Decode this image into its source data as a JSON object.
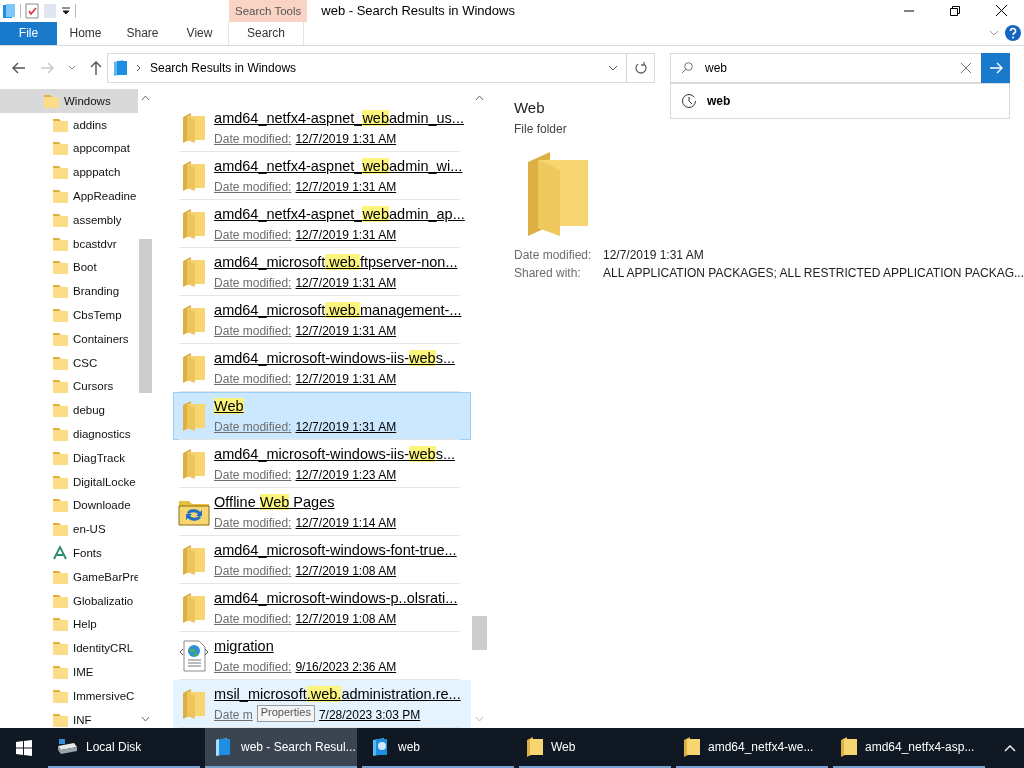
{
  "window": {
    "title": "web - Search Results in Windows",
    "contextual_tab": "Search Tools"
  },
  "ribbon_tabs": [
    {
      "label": "File",
      "kind": "file"
    },
    {
      "label": "Home",
      "kind": "plain"
    },
    {
      "label": "Share",
      "kind": "plain"
    },
    {
      "label": "View",
      "kind": "plain"
    },
    {
      "label": "Search",
      "kind": "contextual"
    }
  ],
  "address": {
    "path": "Search Results in Windows"
  },
  "search": {
    "value": "web",
    "suggestions": [
      "web"
    ]
  },
  "nav_tree": [
    {
      "label": "Windows",
      "kind": "folder",
      "selected": true,
      "children": [
        {
          "label": "addins",
          "kind": "folder",
          "selected": false
        },
        {
          "label": "appcompat",
          "kind": "folder",
          "selected": false
        },
        {
          "label": "apppatch",
          "kind": "folder",
          "selected": false
        },
        {
          "label": "AppReadine",
          "kind": "folder",
          "selected": false
        },
        {
          "label": "assembly",
          "kind": "folder",
          "selected": false
        },
        {
          "label": "bcastdvr",
          "kind": "folder",
          "selected": false
        },
        {
          "label": "Boot",
          "kind": "folder",
          "selected": false
        },
        {
          "label": "Branding",
          "kind": "folder",
          "selected": false
        },
        {
          "label": "CbsTemp",
          "kind": "folder",
          "selected": false
        },
        {
          "label": "Containers",
          "kind": "folder",
          "selected": false
        },
        {
          "label": "CSC",
          "kind": "folder",
          "selected": false
        },
        {
          "label": "Cursors",
          "kind": "folder",
          "selected": false
        },
        {
          "label": "debug",
          "kind": "folder",
          "selected": false
        },
        {
          "label": "diagnostics",
          "kind": "folder",
          "selected": false
        },
        {
          "label": "DiagTrack",
          "kind": "folder",
          "selected": false
        },
        {
          "label": "DigitalLocke",
          "kind": "folder",
          "selected": false
        },
        {
          "label": "Downloade",
          "kind": "folder",
          "selected": false
        },
        {
          "label": "en-US",
          "kind": "folder",
          "selected": false
        },
        {
          "label": "Fonts",
          "kind": "font",
          "selected": false
        },
        {
          "label": "GameBarPre",
          "kind": "folder",
          "selected": false
        },
        {
          "label": "Globalizatio",
          "kind": "folder",
          "selected": false
        },
        {
          "label": "Help",
          "kind": "folder",
          "selected": false
        },
        {
          "label": "IdentityCRL",
          "kind": "folder",
          "selected": false
        },
        {
          "label": "IME",
          "kind": "folder",
          "selected": false
        },
        {
          "label": "ImmersiveC",
          "kind": "folder",
          "selected": false
        },
        {
          "label": "INF",
          "kind": "folder",
          "selected": false
        }
      ]
    }
  ],
  "results": [
    {
      "kind": "folder",
      "selected": false,
      "hovered": false,
      "name": [
        {
          "text": "amd64_netfx4-aspnet_",
          "match": false
        },
        {
          "text": "web",
          "match": true
        },
        {
          "text": "admin_us...",
          "match": false
        }
      ],
      "date_label": "Date modified:",
      "date": "12/7/2019 1:31 AM"
    },
    {
      "kind": "folder",
      "selected": false,
      "hovered": false,
      "name": [
        {
          "text": "amd64_netfx4-aspnet_",
          "match": false
        },
        {
          "text": "web",
          "match": true
        },
        {
          "text": "admin_wi...",
          "match": false
        }
      ],
      "date_label": "Date modified:",
      "date": "12/7/2019 1:31 AM"
    },
    {
      "kind": "folder",
      "selected": false,
      "hovered": false,
      "name": [
        {
          "text": "amd64_netfx4-aspnet_",
          "match": false
        },
        {
          "text": "web",
          "match": true
        },
        {
          "text": "admin_ap...",
          "match": false
        }
      ],
      "date_label": "Date modified:",
      "date": "12/7/2019 1:31 AM"
    },
    {
      "kind": "folder",
      "selected": false,
      "hovered": false,
      "name": [
        {
          "text": "amd64_microsoft",
          "match": false
        },
        {
          "text": ".web.",
          "match": true
        },
        {
          "text": "ftpserver-non...",
          "match": false
        }
      ],
      "date_label": "Date modified:",
      "date": "12/7/2019 1:31 AM"
    },
    {
      "kind": "folder",
      "selected": false,
      "hovered": false,
      "name": [
        {
          "text": "amd64_microsoft",
          "match": false
        },
        {
          "text": ".web.",
          "match": true
        },
        {
          "text": "management-...",
          "match": false
        }
      ],
      "date_label": "Date modified:",
      "date": "12/7/2019 1:31 AM"
    },
    {
      "kind": "folder",
      "selected": false,
      "hovered": false,
      "name": [
        {
          "text": "amd64_microsoft-windows-iis-",
          "match": false
        },
        {
          "text": "web",
          "match": true
        },
        {
          "text": "s...",
          "match": false
        }
      ],
      "date_label": "Date modified:",
      "date": "12/7/2019 1:31 AM"
    },
    {
      "kind": "folder",
      "selected": true,
      "hovered": false,
      "name": [
        {
          "text": "Web",
          "match": true
        }
      ],
      "date_label": "Date modified:",
      "date": "12/7/2019 1:31 AM"
    },
    {
      "kind": "folder",
      "selected": false,
      "hovered": false,
      "name": [
        {
          "text": "amd64_microsoft-windows-iis-",
          "match": false
        },
        {
          "text": "web",
          "match": true
        },
        {
          "text": "s...",
          "match": false
        }
      ],
      "date_label": "Date modified:",
      "date": "12/7/2019 1:23 AM"
    },
    {
      "kind": "sync-folder",
      "selected": false,
      "hovered": false,
      "name": [
        {
          "text": "Offline ",
          "match": false
        },
        {
          "text": "Web",
          "match": true
        },
        {
          "text": " Pages",
          "match": false
        }
      ],
      "date_label": "Date modified:",
      "date": "12/7/2019 1:14 AM"
    },
    {
      "kind": "folder",
      "selected": false,
      "hovered": false,
      "name": [
        {
          "text": "amd64_microsoft-windows-font-true...",
          "match": false
        }
      ],
      "date_label": "Date modified:",
      "date": "12/7/2019 1:08 AM"
    },
    {
      "kind": "folder",
      "selected": false,
      "hovered": false,
      "name": [
        {
          "text": "amd64_microsoft-windows-p..olsrati...",
          "match": false
        }
      ],
      "date_label": "Date modified:",
      "date": "12/7/2019 1:08 AM"
    },
    {
      "kind": "web-document",
      "selected": false,
      "hovered": false,
      "name": [
        {
          "text": "migration",
          "match": false
        }
      ],
      "date_label": "Date modified:",
      "date": "9/16/2023 2:36 AM"
    },
    {
      "kind": "folder",
      "selected": false,
      "hovered": true,
      "name": [
        {
          "text": "msil_microsoft",
          "match": false
        },
        {
          "text": ".web.",
          "match": true
        },
        {
          "text": "administration.re...",
          "match": false
        }
      ],
      "date_label": "Date m",
      "date": "7/28/2023 3:03 PM"
    }
  ],
  "tooltip": "Properties",
  "details": {
    "name": "Web",
    "type": "File folder",
    "properties": [
      {
        "label": "Date modified:",
        "value": "12/7/2019 1:31 AM"
      },
      {
        "label": "Shared with:",
        "value": "ALL APPLICATION PACKAGES; ALL RESTRICTED APPLICATION PACKAG..."
      }
    ]
  },
  "taskbar": [
    {
      "label": "Local Disk",
      "kind": "drive",
      "selected": false
    },
    {
      "label": "web - Search Resul...",
      "kind": "search",
      "selected": true
    },
    {
      "label": "web",
      "kind": "search-globe",
      "selected": false
    },
    {
      "label": "Web",
      "kind": "folder",
      "selected": false
    },
    {
      "label": "amd64_netfx4-we...",
      "kind": "folder",
      "selected": false
    },
    {
      "label": "amd64_netfx4-asp...",
      "kind": "folder",
      "selected": false
    }
  ]
}
